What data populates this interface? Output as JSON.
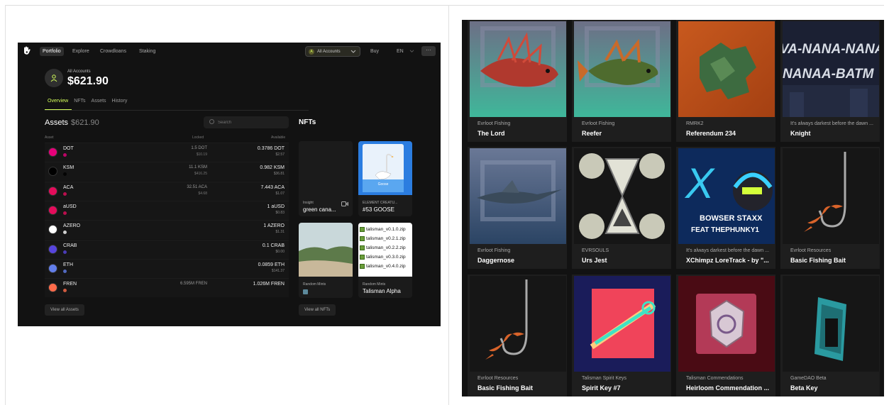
{
  "portfolio": {
    "nav": [
      "Portfolio",
      "Explore",
      "Crowdloans",
      "Staking"
    ],
    "account_selector": "All Accounts",
    "buy": "Buy",
    "lang": "EN",
    "more": "···",
    "account_label": "All Accounts",
    "account_total": "$621.90",
    "tabs": [
      "Overview",
      "NFTs",
      "Assets",
      "History"
    ],
    "assets_title": "Assets",
    "assets_total": "$621.90",
    "search_placeholder": "Search",
    "columns": [
      "Asset",
      "Locked",
      "Available"
    ],
    "assets": [
      {
        "symbol": "DOT",
        "locked": "1.5 DOT",
        "locked_usd": "$10.19",
        "avail": "0.3786 DOT",
        "avail_usd": "$2.57",
        "color": "#e6007a"
      },
      {
        "symbol": "KSM",
        "locked": "11.1 KSM",
        "locked_usd": "$416.25",
        "avail": "0.982 KSM",
        "avail_usd": "$36.81",
        "color": "#000000"
      },
      {
        "symbol": "ACA",
        "locked": "32.51 ACA",
        "locked_usd": "$4.68",
        "avail": "7.443 ACA",
        "avail_usd": "$1.07",
        "color": "#e40c5b"
      },
      {
        "symbol": "aUSD",
        "locked": "",
        "locked_usd": "",
        "avail": "1 aUSD",
        "avail_usd": "$0.83",
        "color": "#e40c5b"
      },
      {
        "symbol": "AZERO",
        "locked": "",
        "locked_usd": "",
        "avail": "1 AZERO",
        "avail_usd": "$1.31",
        "color": "#ffffff"
      },
      {
        "symbol": "CRAB",
        "locked": "",
        "locked_usd": "",
        "avail": "0.1 CRAB",
        "avail_usd": "$0.00",
        "color": "#5745de"
      },
      {
        "symbol": "ETH",
        "locked": "",
        "locked_usd": "",
        "avail": "0.0859 ETH",
        "avail_usd": "$141.37",
        "color": "#627eea"
      },
      {
        "symbol": "FREN",
        "locked": "6.595M FREN",
        "locked_usd": "",
        "avail": "1.026M FREN",
        "avail_usd": "",
        "color": "#ff6b4a"
      }
    ],
    "view_all_assets": "View all Assets",
    "nfts_title": "NFTs",
    "nfts": [
      {
        "collection": "Insight",
        "name": "green cana..."
      },
      {
        "collection": "ELEMENT CREATU...",
        "name": "#53 GOOSE"
      },
      {
        "collection": "Random Mints",
        "name": ""
      },
      {
        "collection": "Random Mints",
        "name": "Talisman Alpha"
      }
    ],
    "goose_label": "Goose",
    "zip_files": [
      "talisman_v0.1.0.zip",
      "talisman_v0.2.1.zip",
      "talisman_v0.2.2.zip",
      "talisman_v0.3.0.zip",
      "talisman_v0.4.0.zip"
    ],
    "view_all_nfts": "View all NFTs"
  },
  "grid": [
    {
      "collection": "Evrloot Fishing",
      "name": "The Lord"
    },
    {
      "collection": "Evrloot Fishing",
      "name": "Reefer"
    },
    {
      "collection": "RMRK2",
      "name": "Referendum 234"
    },
    {
      "collection": "It's always darkest before the dawn ...",
      "name": "Knight"
    },
    {
      "collection": "Evrloot Fishing",
      "name": "Daggernose"
    },
    {
      "collection": "EVRSOULS",
      "name": "Urs Jest"
    },
    {
      "collection": "It's always darkest before the dawn ...",
      "name": "XChimpz LoreTrack - by \"..."
    },
    {
      "collection": "Evrloot Resources",
      "name": "Basic Fishing Bait"
    },
    {
      "collection": "Evrloot Resources",
      "name": "Basic Fishing Bait"
    },
    {
      "collection": "Talisman Spirit Keys",
      "name": "Spirit Key #7"
    },
    {
      "collection": "Talisman Commendations",
      "name": "Heirloom Commendation ..."
    },
    {
      "collection": "GameDAO Beta",
      "name": "Beta Key"
    }
  ],
  "artwork_text": {
    "knight_1": "VA-NANA-NANA",
    "knight_2": "NANAA-BATM",
    "xchimpz_1": "BOWSER STAXX",
    "xchimpz_2": "FEAT THEPHUNKY1"
  }
}
